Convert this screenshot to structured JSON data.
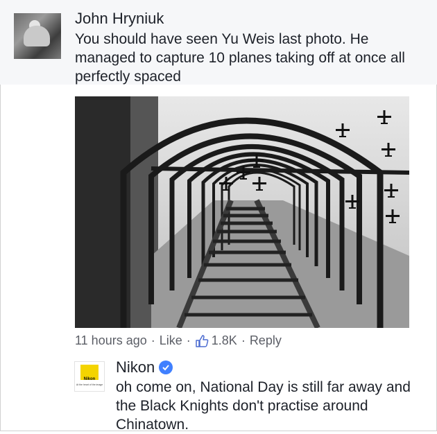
{
  "comment": {
    "author": "John Hryniuk",
    "text": "You should have seen Yu Weis last photo. He managed to capture 10 planes taking off at once all perfectly spaced",
    "meta": {
      "time": "11 hours ago",
      "like_label": "Like",
      "like_count": "1.8K",
      "reply_label": "Reply",
      "separator": "·"
    },
    "avatar_icon": "profile-photo-icon",
    "photo_icon": "ladder-planes-photo"
  },
  "reply": {
    "author": "Nikon",
    "verified": true,
    "text": "oh come on, National Day is still far away and the Black Knights don't practise around Chinatown.",
    "avatar": {
      "logo_text": "Nikon",
      "tagline": "At the heart of the image"
    }
  },
  "colors": {
    "text": "#1d2129",
    "meta": "#5b5e66",
    "verified": "#4080ff",
    "nikon_yellow": "#f4d400"
  }
}
